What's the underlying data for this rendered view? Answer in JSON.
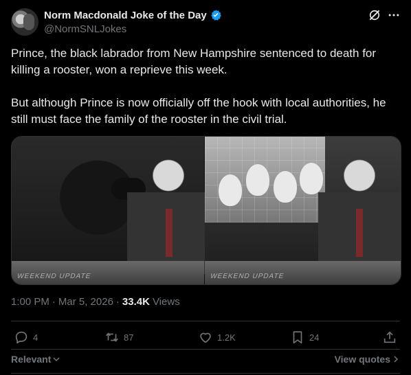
{
  "author": {
    "name": "Norm Macdonald Joke of the Day",
    "handle": "@NormSNLJokes"
  },
  "tweet": {
    "text": "Prince, the black labrador from New Hampshire sentenced to death for killing a rooster, won a reprieve this week.\n\nBut although Prince is now officially off the hook with local authorities, he still must face the family of the rooster in the civil trial."
  },
  "media": {
    "desk_text_left": "WEEKEND UPDATE",
    "desk_text_right": "WEEKEND UPDATE"
  },
  "meta": {
    "time": "1:00 PM",
    "dot1": "·",
    "date": "Mar 5, 2026",
    "dot2": "·",
    "views_count": "33.4K",
    "views_label": "Views"
  },
  "actions": {
    "replies": "4",
    "reposts": "87",
    "likes": "1.2K",
    "bookmarks": "24"
  },
  "footer": {
    "relevant": "Relevant",
    "view_quotes": "View quotes"
  },
  "colors": {
    "background": "#000000",
    "text": "#e7e9ea",
    "muted": "#71767b",
    "verified": "#1d9bf0",
    "border": "#2f3336"
  }
}
